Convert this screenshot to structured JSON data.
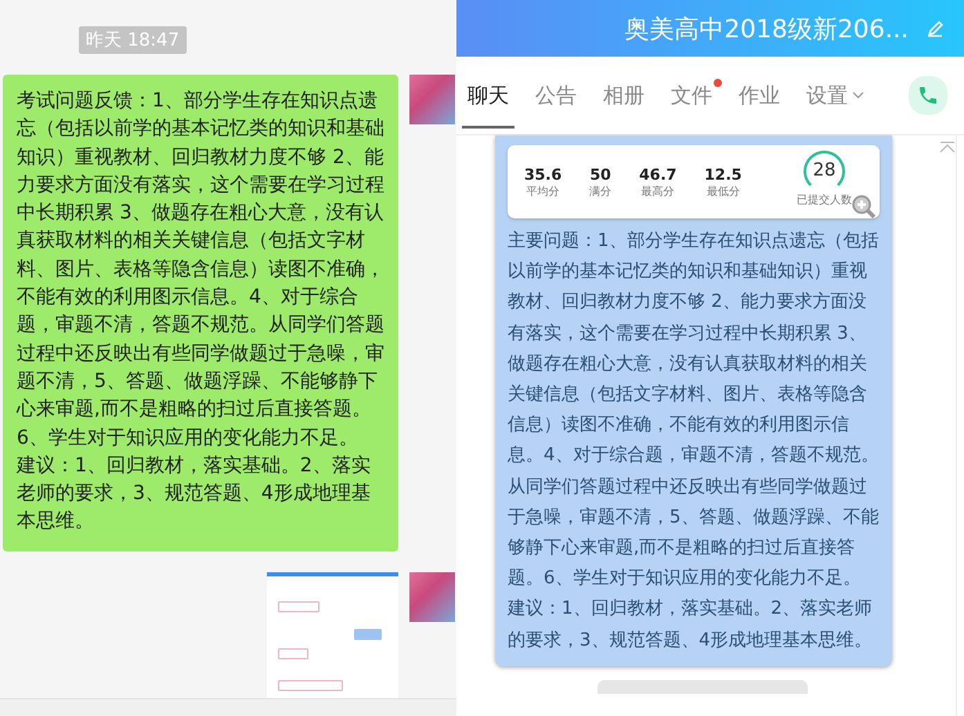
{
  "left_chat": {
    "timestamp": "昨天 18:47",
    "messages": [
      {
        "kind": "text",
        "paragraphs": [
          "考试问题反馈：1、部分学生存在知识点遗忘（包括以前学的基本记忆类的知识和基础知识）重视教材、回归教材力度不够  2、能力要求方面没有落实，这个需要在学习过程中长期积累  3、做题存在粗心大意，没有认真获取材料的相关关键信息（包括文字材料、图片、表格等隐含信息）读图不准确，不能有效的利用图示信息。4、对于综合题，审题不清，答题不规范。从同学们答题过程中还反映出有些同学做题过于急噪，审题不清，5、答题、做题浮躁、不能够静下心来审题,而不是粗略的扫过后直接答题。6、学生对于知识应用的变化能力不足。",
          "建议：1、回归教材，落实基础。2、落实老师的要求，3、规范答题、4形成地理基本思维。"
        ]
      },
      {
        "kind": "image"
      }
    ]
  },
  "group_window": {
    "title": "奥美高中2018级新206...",
    "tabs": [
      {
        "label": "聊天",
        "selected": true,
        "badge": false
      },
      {
        "label": "公告",
        "selected": false,
        "badge": false
      },
      {
        "label": "相册",
        "selected": false,
        "badge": false
      },
      {
        "label": "文件",
        "selected": false,
        "badge": true
      },
      {
        "label": "作业",
        "selected": false,
        "badge": false
      },
      {
        "label": "设置",
        "selected": false,
        "badge": false,
        "dropdown": true
      }
    ],
    "stats": [
      {
        "value": "35.6",
        "label": "平均分"
      },
      {
        "value": "50",
        "label": "满分"
      },
      {
        "value": "46.7",
        "label": "最高分"
      },
      {
        "value": "12.5",
        "label": "最低分"
      }
    ],
    "submitted": {
      "value": "28",
      "label": "已提交人数"
    },
    "message": [
      "主要问题：1、部分学生存在知识点遗忘（包括以前学的基本记忆类的知识和基础知识）重视教材、回归教材力度不够  2、能力要求方面没有落实，这个需要在学习过程中长期积累  3、做题存在粗心大意，没有认真获取材料的相关关键信息（包括文字材料、图片、表格等隐含信息）读图不准确，不能有效的利用图示信息。4、对于综合题，审题不清，答题不规范。从同学们答题过程中还反映出有些同学做题过于急噪，审题不清，5、答题、做题浮躁、不能够静下心来审题,而不是粗略的扫过后直接答题。6、学生对于知识应用的变化能力不足。",
      "建议：1、回归教材，落实基础。2、落实老师的要求，3、规范答题、4形成地理基本思维。"
    ]
  }
}
